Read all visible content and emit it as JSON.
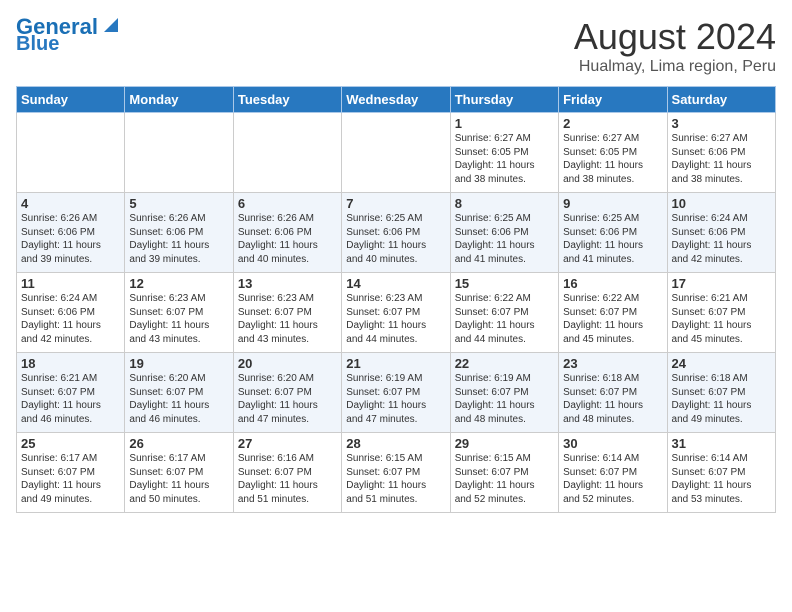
{
  "header": {
    "logo_line1": "General",
    "logo_line2": "Blue",
    "title": "August 2024",
    "subtitle": "Hualmay, Lima region, Peru"
  },
  "weekdays": [
    "Sunday",
    "Monday",
    "Tuesday",
    "Wednesday",
    "Thursday",
    "Friday",
    "Saturday"
  ],
  "weeks": [
    [
      {
        "day": "",
        "info": ""
      },
      {
        "day": "",
        "info": ""
      },
      {
        "day": "",
        "info": ""
      },
      {
        "day": "",
        "info": ""
      },
      {
        "day": "1",
        "info": "Sunrise: 6:27 AM\nSunset: 6:05 PM\nDaylight: 11 hours\nand 38 minutes."
      },
      {
        "day": "2",
        "info": "Sunrise: 6:27 AM\nSunset: 6:05 PM\nDaylight: 11 hours\nand 38 minutes."
      },
      {
        "day": "3",
        "info": "Sunrise: 6:27 AM\nSunset: 6:06 PM\nDaylight: 11 hours\nand 38 minutes."
      }
    ],
    [
      {
        "day": "4",
        "info": "Sunrise: 6:26 AM\nSunset: 6:06 PM\nDaylight: 11 hours\nand 39 minutes."
      },
      {
        "day": "5",
        "info": "Sunrise: 6:26 AM\nSunset: 6:06 PM\nDaylight: 11 hours\nand 39 minutes."
      },
      {
        "day": "6",
        "info": "Sunrise: 6:26 AM\nSunset: 6:06 PM\nDaylight: 11 hours\nand 40 minutes."
      },
      {
        "day": "7",
        "info": "Sunrise: 6:25 AM\nSunset: 6:06 PM\nDaylight: 11 hours\nand 40 minutes."
      },
      {
        "day": "8",
        "info": "Sunrise: 6:25 AM\nSunset: 6:06 PM\nDaylight: 11 hours\nand 41 minutes."
      },
      {
        "day": "9",
        "info": "Sunrise: 6:25 AM\nSunset: 6:06 PM\nDaylight: 11 hours\nand 41 minutes."
      },
      {
        "day": "10",
        "info": "Sunrise: 6:24 AM\nSunset: 6:06 PM\nDaylight: 11 hours\nand 42 minutes."
      }
    ],
    [
      {
        "day": "11",
        "info": "Sunrise: 6:24 AM\nSunset: 6:06 PM\nDaylight: 11 hours\nand 42 minutes."
      },
      {
        "day": "12",
        "info": "Sunrise: 6:23 AM\nSunset: 6:07 PM\nDaylight: 11 hours\nand 43 minutes."
      },
      {
        "day": "13",
        "info": "Sunrise: 6:23 AM\nSunset: 6:07 PM\nDaylight: 11 hours\nand 43 minutes."
      },
      {
        "day": "14",
        "info": "Sunrise: 6:23 AM\nSunset: 6:07 PM\nDaylight: 11 hours\nand 44 minutes."
      },
      {
        "day": "15",
        "info": "Sunrise: 6:22 AM\nSunset: 6:07 PM\nDaylight: 11 hours\nand 44 minutes."
      },
      {
        "day": "16",
        "info": "Sunrise: 6:22 AM\nSunset: 6:07 PM\nDaylight: 11 hours\nand 45 minutes."
      },
      {
        "day": "17",
        "info": "Sunrise: 6:21 AM\nSunset: 6:07 PM\nDaylight: 11 hours\nand 45 minutes."
      }
    ],
    [
      {
        "day": "18",
        "info": "Sunrise: 6:21 AM\nSunset: 6:07 PM\nDaylight: 11 hours\nand 46 minutes."
      },
      {
        "day": "19",
        "info": "Sunrise: 6:20 AM\nSunset: 6:07 PM\nDaylight: 11 hours\nand 46 minutes."
      },
      {
        "day": "20",
        "info": "Sunrise: 6:20 AM\nSunset: 6:07 PM\nDaylight: 11 hours\nand 47 minutes."
      },
      {
        "day": "21",
        "info": "Sunrise: 6:19 AM\nSunset: 6:07 PM\nDaylight: 11 hours\nand 47 minutes."
      },
      {
        "day": "22",
        "info": "Sunrise: 6:19 AM\nSunset: 6:07 PM\nDaylight: 11 hours\nand 48 minutes."
      },
      {
        "day": "23",
        "info": "Sunrise: 6:18 AM\nSunset: 6:07 PM\nDaylight: 11 hours\nand 48 minutes."
      },
      {
        "day": "24",
        "info": "Sunrise: 6:18 AM\nSunset: 6:07 PM\nDaylight: 11 hours\nand 49 minutes."
      }
    ],
    [
      {
        "day": "25",
        "info": "Sunrise: 6:17 AM\nSunset: 6:07 PM\nDaylight: 11 hours\nand 49 minutes."
      },
      {
        "day": "26",
        "info": "Sunrise: 6:17 AM\nSunset: 6:07 PM\nDaylight: 11 hours\nand 50 minutes."
      },
      {
        "day": "27",
        "info": "Sunrise: 6:16 AM\nSunset: 6:07 PM\nDaylight: 11 hours\nand 51 minutes."
      },
      {
        "day": "28",
        "info": "Sunrise: 6:15 AM\nSunset: 6:07 PM\nDaylight: 11 hours\nand 51 minutes."
      },
      {
        "day": "29",
        "info": "Sunrise: 6:15 AM\nSunset: 6:07 PM\nDaylight: 11 hours\nand 52 minutes."
      },
      {
        "day": "30",
        "info": "Sunrise: 6:14 AM\nSunset: 6:07 PM\nDaylight: 11 hours\nand 52 minutes."
      },
      {
        "day": "31",
        "info": "Sunrise: 6:14 AM\nSunset: 6:07 PM\nDaylight: 11 hours\nand 53 minutes."
      }
    ]
  ]
}
